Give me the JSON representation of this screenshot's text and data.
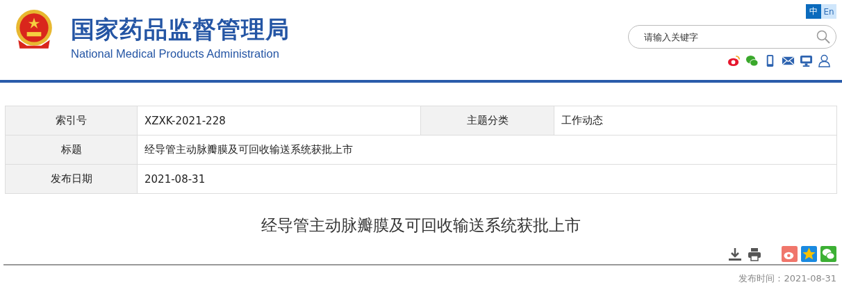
{
  "header": {
    "title": "国家药品监督管理局",
    "subtitle": "National Medical Products Administration"
  },
  "languages": [
    {
      "label": "中",
      "selected": true
    },
    {
      "label": "En",
      "selected": false
    }
  ],
  "search": {
    "placeholder": "请输入关键字"
  },
  "info_table": {
    "rows": [
      {
        "cells": [
          {
            "label": "索引号",
            "value": "XZXK-2021-228"
          },
          {
            "label": "主题分类",
            "value": "工作动态"
          }
        ]
      },
      {
        "cells": [
          {
            "label": "标题",
            "value": "经导管主动脉瓣膜及可回收输送系统获批上市"
          }
        ]
      },
      {
        "cells": [
          {
            "label": "发布日期",
            "value": "2021-08-31"
          }
        ]
      }
    ]
  },
  "article": {
    "title": "经导管主动脉瓣膜及可回收输送系统获批上市",
    "publish_time": "发布时间：2021-08-31"
  }
}
